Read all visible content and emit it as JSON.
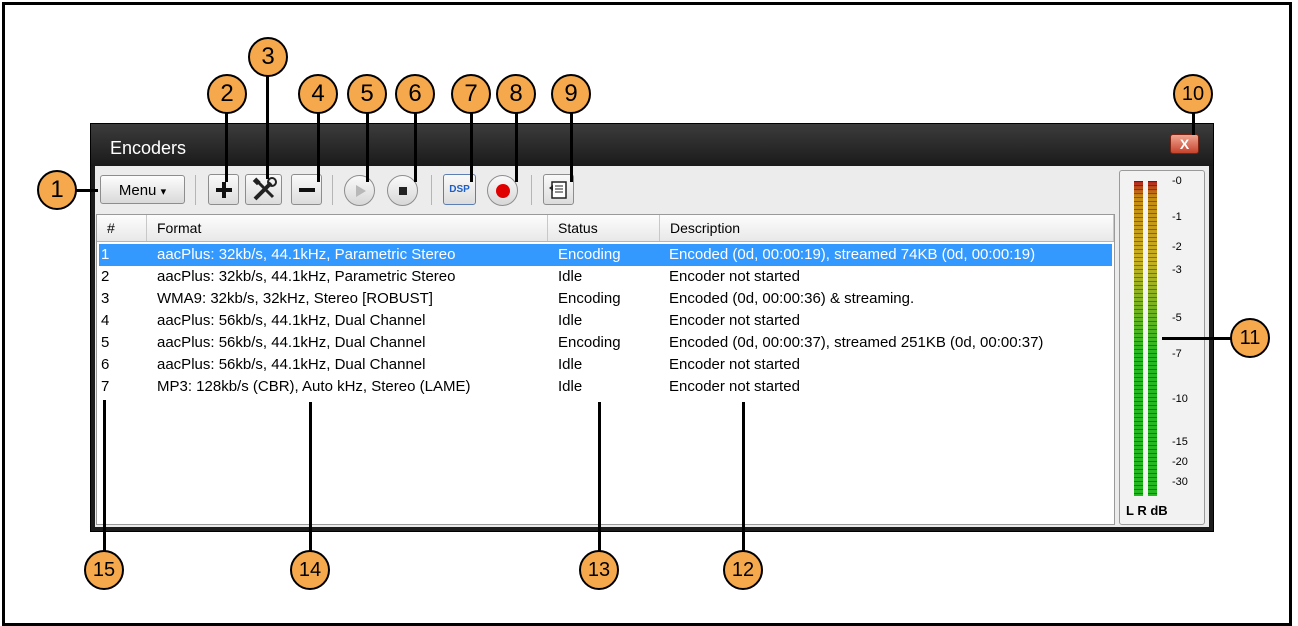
{
  "window": {
    "title": "Encoders",
    "close_label": "X"
  },
  "toolbar": {
    "menu_label": "Menu",
    "menu_arrow": "▾",
    "dsp_label": "DSP"
  },
  "columns": [
    "#",
    "Format",
    "Status",
    "Description"
  ],
  "rows": [
    {
      "num": "1",
      "format": "aacPlus: 32kb/s, 44.1kHz, Parametric Stereo",
      "status": "Encoding",
      "description": "Encoded (0d, 00:00:19), streamed 74KB (0d, 00:00:19)",
      "selected": true
    },
    {
      "num": "2",
      "format": "aacPlus: 32kb/s, 44.1kHz, Parametric Stereo",
      "status": "Idle",
      "description": "Encoder not started"
    },
    {
      "num": "3",
      "format": "WMA9: 32kb/s, 32kHz, Stereo [ROBUST]",
      "status": "Encoding",
      "description": "Encoded (0d, 00:00:36) & streaming."
    },
    {
      "num": "4",
      "format": "aacPlus: 56kb/s, 44.1kHz, Dual Channel",
      "status": "Idle",
      "description": "Encoder not started"
    },
    {
      "num": "5",
      "format": "aacPlus: 56kb/s, 44.1kHz, Dual Channel",
      "status": "Encoding",
      "description": "Encoded (0d, 00:00:37), streamed 251KB (0d, 00:00:37)"
    },
    {
      "num": "6",
      "format": "aacPlus: 56kb/s, 44.1kHz, Dual Channel",
      "status": "Idle",
      "description": "Encoder not started"
    },
    {
      "num": "7",
      "format": "MP3: 128kb/s (CBR), Auto kHz, Stereo (LAME)",
      "status": "Idle",
      "description": "Encoder not started"
    }
  ],
  "meter": {
    "ticks": [
      "-0",
      "-1",
      "-2",
      "-3",
      "-5",
      "-7",
      "-10",
      "-15",
      "-20",
      "-30"
    ],
    "label": "L R dB"
  },
  "callouts": [
    "1",
    "2",
    "3",
    "4",
    "5",
    "6",
    "7",
    "8",
    "9",
    "10",
    "11",
    "12",
    "13",
    "14",
    "15"
  ],
  "colors": {
    "selection": "#3399ff",
    "callout": "#f5a84c",
    "titlebar": "#1a1a1a",
    "record": "#e00000"
  }
}
